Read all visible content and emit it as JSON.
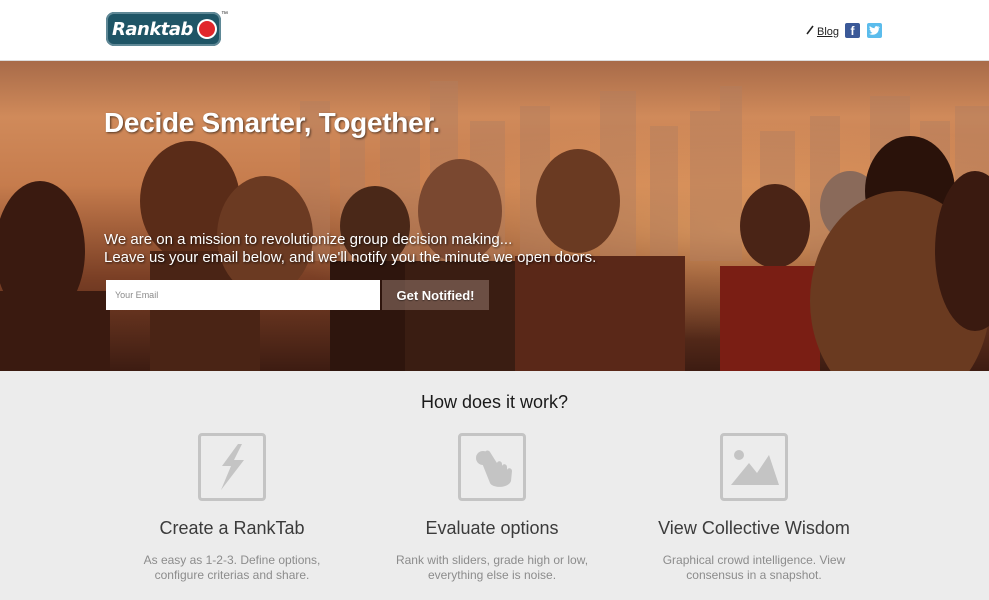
{
  "header": {
    "logo_text": "Ranktab",
    "logo_tm": "™",
    "blog_label": "Blog",
    "pencil_icon": "pencil-icon",
    "facebook_icon": "facebook-icon",
    "facebook_glyph": "f",
    "twitter_icon": "twitter-icon",
    "twitter_glyph": "t"
  },
  "hero": {
    "title": "Decide Smarter, Together.",
    "line1": "We are on a mission to revolutionize group decision making...",
    "line2": "Leave us your email below, and we'll notify you the minute we open doors.",
    "email_placeholder": "Your Email",
    "email_value": "",
    "button_label": "Get Notified!"
  },
  "how": {
    "title": "How does it work?",
    "features": [
      {
        "icon": "lightning-bolt-icon",
        "title": "Create a RankTab",
        "desc": "As easy as 1-2-3. Define options, configure criterias and share."
      },
      {
        "icon": "touch-hand-icon",
        "title": "Evaluate options",
        "desc": "Rank with sliders, grade high or low, everything else is noise."
      },
      {
        "icon": "picture-mountain-icon",
        "title": "View Collective Wisdom",
        "desc": "Graphical crowd intelligence. View consensus in a snapshot."
      }
    ]
  },
  "colors": {
    "logo_bg": "#1f5566",
    "logo_dot": "#e1262b",
    "facebook": "#3b5998",
    "twitter": "#5bbcec",
    "feature_icon_border": "#c4c4c4"
  }
}
